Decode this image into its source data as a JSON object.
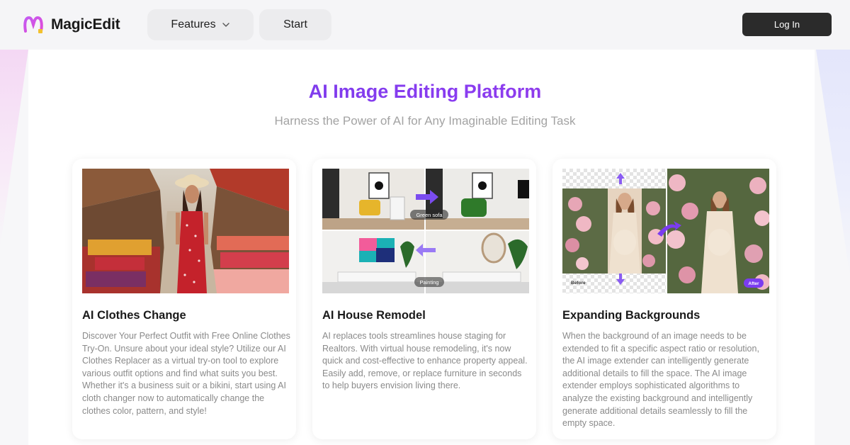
{
  "header": {
    "logo_text": "MagicEdit",
    "nav": [
      {
        "label": "Features",
        "has_dropdown": true
      },
      {
        "label": "Start"
      }
    ],
    "login_label": "Log In"
  },
  "hero": {
    "title": "AI Image Editing Platform",
    "subtitle": "Harness the Power of AI for Any Imaginable Editing Task"
  },
  "cards": [
    {
      "title": "AI Clothes Change",
      "description": "Discover Your Perfect Outfit with Free Online Clothes Try-On. Unsure about your ideal style? Utilize our AI Clothes Replacer as a virtual try-on tool to explore various outfit options and find what suits you best. Whether it's a business suit or a bikini, start using AI cloth changer now to automatically change the clothes color, pattern, and style!"
    },
    {
      "title": "AI House Remodel",
      "description": "AI replaces tools streamlines house staging for Realtors. With virtual house remodeling, it's now quick and cost-effective to enhance property appeal. Easily add, remove, or replace furniture in seconds to help buyers envision living there.",
      "image_labels": {
        "top": "Green sofa",
        "bottom": "Painting"
      }
    },
    {
      "title": "Expanding Backgrounds",
      "description": "When the background of an image needs to be extended to fit a specific aspect ratio or resolution, the AI image extender can intelligently generate additional details to fill the space. The AI image extender employs sophisticated algorithms to analyze the existing background and intelligently generate additional details seamlessly to fill the empty space.",
      "image_labels": {
        "before": "Before",
        "after": "After"
      }
    }
  ],
  "colors": {
    "accent_purple": "#7b3cf0",
    "login_bg": "#2b2b2b",
    "subtitle_gray": "#a3a3a3"
  },
  "icons": [
    "magicedit-logo-icon",
    "chevron-down-icon",
    "arrow-right-icon",
    "arrow-left-icon",
    "arrow-up-icon",
    "arrow-down-icon"
  ]
}
